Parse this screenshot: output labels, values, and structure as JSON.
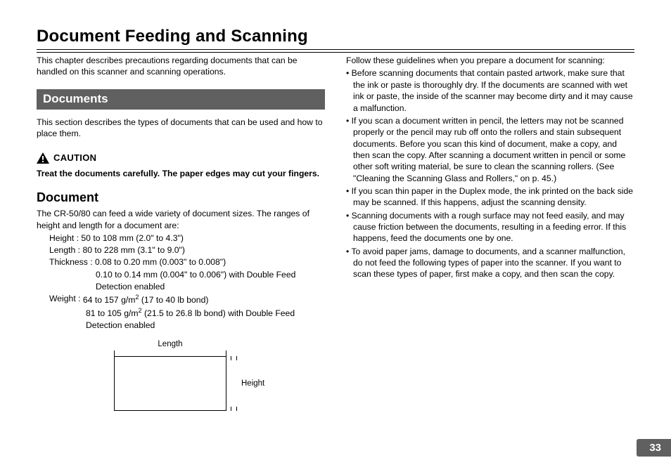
{
  "chapter_title": "Document Feeding and Scanning",
  "intro": "This chapter describes precautions regarding documents that can be handled on this scanner and scanning operations.",
  "section": {
    "title": "Documents",
    "desc": "This section describes the types of documents that can be used and how to place them."
  },
  "caution": {
    "label": "CAUTION",
    "text": "Treat the documents carefully. The paper edges may cut your fingers."
  },
  "document": {
    "heading": "Document",
    "intro": "The CR-50/80 can feed a wide variety of document sizes. The ranges of height and length for a document are:",
    "height_label": "Height : ",
    "height_val": "50 to 108 mm (2.0\" to 4.3\")",
    "length_label": "Length : ",
    "length_val": "80 to 228 mm (3.1\" to 9.0\")",
    "thickness_label": "Thickness : ",
    "thickness_val": "0.08 to 0.20 mm (0.003\" to 0.008\")",
    "thickness_val2": "0.10 to 0.14 mm (0.004\" to 0.006\") with Double Feed Detection enabled",
    "weight_label": "Weight : ",
    "weight_val_pre": "64 to 157 g/m",
    "weight_val_post": " (17 to 40 lb bond)",
    "weight_val2_pre": "81 to 105 g/m",
    "weight_val2_post": " (21.5 to 26.8 lb bond) with Double Feed Detection enabled"
  },
  "diagram": {
    "length": "Length",
    "height": "Height"
  },
  "guidelines": {
    "intro": "Follow these guidelines when you prepare a document for scanning:",
    "items": [
      "Before scanning documents that contain pasted artwork, make sure that the ink or paste is thoroughly dry. If the documents are scanned with wet ink or paste, the inside of the scanner may become dirty and it may cause a malfunction.",
      "If you scan a document written in pencil, the letters may not be scanned properly or the pencil may rub off onto the rollers and stain subsequent documents. Before you scan this kind of document, make a copy, and then scan the copy. After scanning a document written in pencil or some other soft writing material, be sure to clean the scanning rollers. (See \"Cleaning the Scanning Glass and Rollers,\" on p. 45.)",
      "If you scan thin paper in the Duplex mode, the ink printed on the back side may be scanned. If this happens, adjust the scanning density.",
      "Scanning documents with a rough surface may not feed easily, and may cause friction between the documents, resulting in a feeding error. If this happens, feed the documents one by one.",
      "To avoid paper jams, damage to documents, and a scanner malfunction, do not feed the following types of paper into the scanner. If you want to scan these types of paper, first make a copy, and then scan the copy."
    ]
  },
  "page_number": "33"
}
